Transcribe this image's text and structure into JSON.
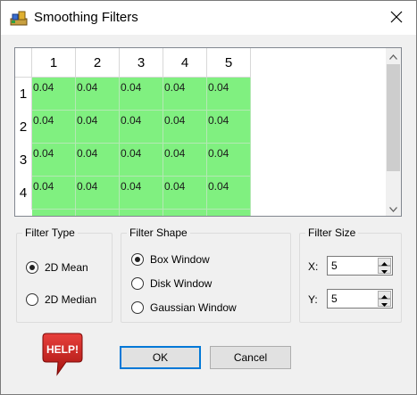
{
  "window": {
    "title": "Smoothing Filters"
  },
  "grid": {
    "columns": [
      "1",
      "2",
      "3",
      "4",
      "5"
    ],
    "rows": [
      {
        "label": "1",
        "cells": [
          "0.04",
          "0.04",
          "0.04",
          "0.04",
          "0.04"
        ]
      },
      {
        "label": "2",
        "cells": [
          "0.04",
          "0.04",
          "0.04",
          "0.04",
          "0.04"
        ]
      },
      {
        "label": "3",
        "cells": [
          "0.04",
          "0.04",
          "0.04",
          "0.04",
          "0.04"
        ]
      },
      {
        "label": "4",
        "cells": [
          "0.04",
          "0.04",
          "0.04",
          "0.04",
          "0.04"
        ]
      }
    ],
    "cell_color": "#80f080"
  },
  "filter_type": {
    "title": "Filter Type",
    "options": [
      {
        "label": "2D Mean",
        "checked": true
      },
      {
        "label": "2D Median",
        "checked": false
      }
    ]
  },
  "filter_shape": {
    "title": "Filter Shape",
    "options": [
      {
        "label": "Box Window",
        "checked": true
      },
      {
        "label": "Disk Window",
        "checked": false
      },
      {
        "label": "Gaussian Window",
        "checked": false
      }
    ]
  },
  "filter_size": {
    "title": "Filter Size",
    "x_label": "X:",
    "x_value": "5",
    "y_label": "Y:",
    "y_value": "5"
  },
  "buttons": {
    "ok": "OK",
    "cancel": "Cancel",
    "help": "HELP!"
  },
  "colors": {
    "accent": "#0078d7",
    "help_red": "#c8201e"
  }
}
